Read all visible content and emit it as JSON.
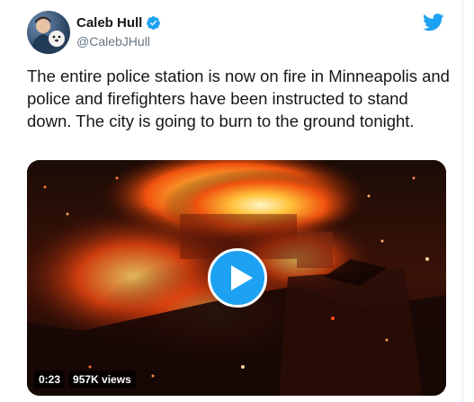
{
  "tweet": {
    "display_name": "Caleb Hull",
    "verified_icon": "verified-badge-icon",
    "handle": "@CalebJHull",
    "text": "The entire police station is now on fire in Minneapolis and police and firefighters have been instructed to stand down. The city is going to burn to the ground tonight.",
    "brand_icon": "twitter-bird-icon",
    "accent_color": "#1da1f2"
  },
  "video": {
    "duration": "0:23",
    "views": "957K views",
    "play_icon": "play-icon"
  }
}
